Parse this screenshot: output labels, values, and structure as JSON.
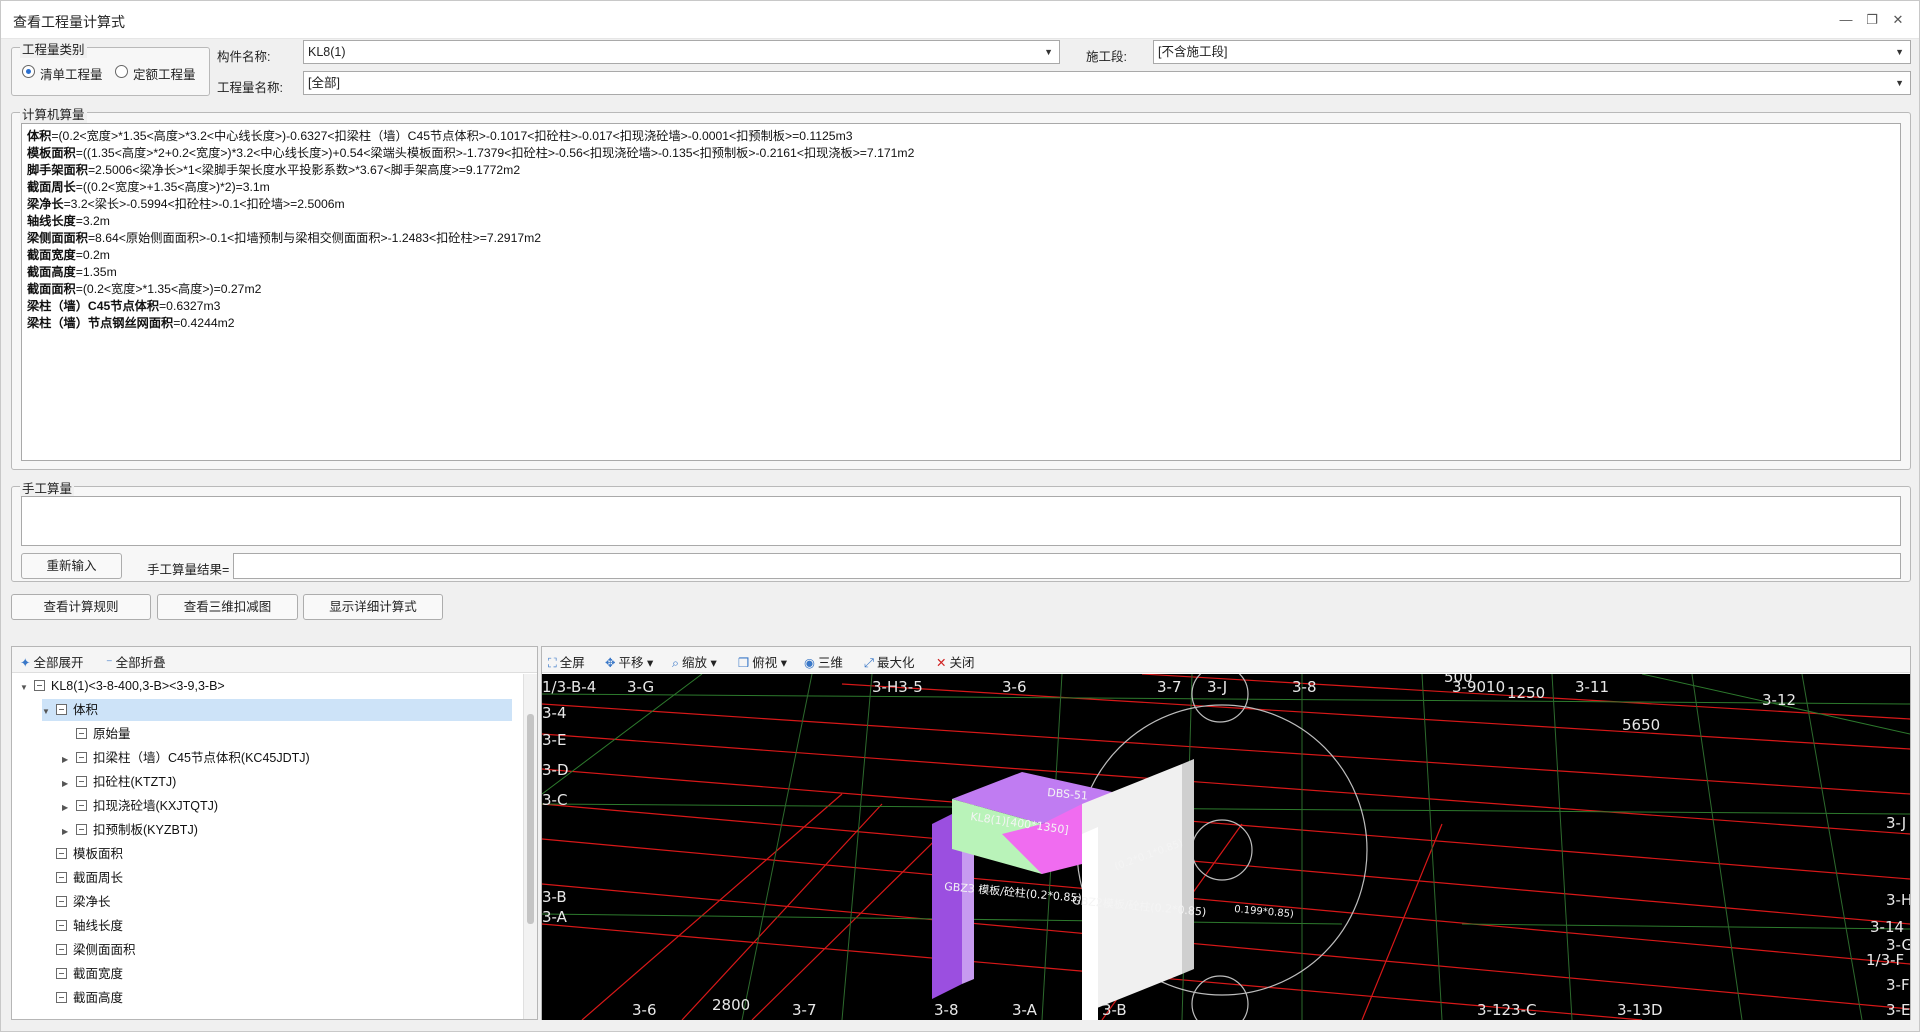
{
  "window": {
    "title": "查看工程量计算式"
  },
  "category": {
    "group_label": "工程量类别",
    "option1": "清单工程量",
    "option2": "定额工程量"
  },
  "fields": {
    "component_label": "构件名称:",
    "component_value": "KL8(1)",
    "stage_label": "施工段:",
    "stage_value": "[不含施工段]",
    "qty_label": "工程量名称:",
    "qty_value": "[全部]"
  },
  "calc": {
    "group_label": "计算机算量",
    "lines": [
      {
        "k": "体积",
        "v": "=(0.2<宽度>*1.35<高度>*3.2<中心线长度>)-0.6327<扣梁柱（墙）C45节点体积>-0.1017<扣砼柱>-0.017<扣现浇砼墙>-0.0001<扣预制板>=0.1125m3"
      },
      {
        "k": "模板面积",
        "v": "=((1.35<高度>*2+0.2<宽度>)*3.2<中心线长度>)+0.54<梁端头模板面积>-1.7379<扣砼柱>-0.56<扣现浇砼墙>-0.135<扣预制板>-0.2161<扣现浇板>=7.171m2"
      },
      {
        "k": "脚手架面积",
        "v": "=2.5006<梁净长>*1<梁脚手架长度水平投影系数>*3.67<脚手架高度>=9.1772m2"
      },
      {
        "k": "截面周长",
        "v": "=((0.2<宽度>+1.35<高度>)*2)=3.1m"
      },
      {
        "k": "梁净长",
        "v": "=3.2<梁长>-0.5994<扣砼柱>-0.1<扣砼墙>=2.5006m"
      },
      {
        "k": "轴线长度",
        "v": "=3.2m"
      },
      {
        "k": "梁侧面面积",
        "v": "=8.64<原始侧面面积>-0.1<扣墙预制与梁相交侧面面积>-1.2483<扣砼柱>=7.2917m2"
      },
      {
        "k": "截面宽度",
        "v": "=0.2m"
      },
      {
        "k": "截面高度",
        "v": "=1.35m"
      },
      {
        "k": "截面面积",
        "v": "=(0.2<宽度>*1.35<高度>)=0.27m2"
      },
      {
        "k": "梁柱（墙）C45节点体积",
        "v": "=0.6327m3"
      },
      {
        "k": "梁柱（墙）节点钢丝网面积",
        "v": "=0.4244m2"
      }
    ]
  },
  "manual": {
    "group_label": "手工算量",
    "reinput": "重新输入",
    "result_label": "手工算量结果="
  },
  "buttons": {
    "rules": "查看计算规则",
    "view3d": "查看三维扣减图",
    "detail": "显示详细计算式"
  },
  "tree": {
    "expand_all": "全部展开",
    "collapse_all": "全部折叠",
    "nodes": [
      "KL8(1)<3-8-400,3-B><3-9,3-B>",
      "体积",
      "原始量",
      "扣梁柱（墙）C45节点体积(KC45JDTJ)",
      "扣砼柱(KTZTJ)",
      "扣现浇砼墙(KXJTQTJ)",
      "扣预制板(KYZBTJ)",
      "模板面积",
      "截面周长",
      "梁净长",
      "轴线长度",
      "梁侧面面积",
      "截面宽度",
      "截面高度"
    ]
  },
  "view": {
    "fullscreen": "全屏",
    "pan": "平移",
    "zoom": "缩放",
    "topview": "俯视",
    "view3d": "三维",
    "maximize": "最大化",
    "close": "关闭",
    "axes": [
      "1/3-B-4",
      "3-G",
      "3-H3-5",
      "3-6",
      "3-7",
      "3-J",
      "3-8",
      "3-9010",
      "1250",
      "3-11",
      "3-12",
      "5650",
      "3-4",
      "3-E",
      "3-D",
      "3-C",
      "3-B",
      "3-A",
      "3-6",
      "2800",
      "3-7",
      "3-8",
      "3-A",
      "3-B",
      "3-123-C",
      "3-13D",
      "3-E",
      "3-F",
      "1/3-F",
      "3-G",
      "3-14",
      "3-H",
      "3-J",
      "500"
    ],
    "labels": [
      "DBS-51",
      "KL8(1)[400*1350]",
      "GBZ3 模板/砼柱(0.2*0.85)",
      "GBZ2模板/砼柱(0.2*0.85)",
      "(0.2*0.1*0.85)",
      "0.199*0.85)"
    ]
  }
}
